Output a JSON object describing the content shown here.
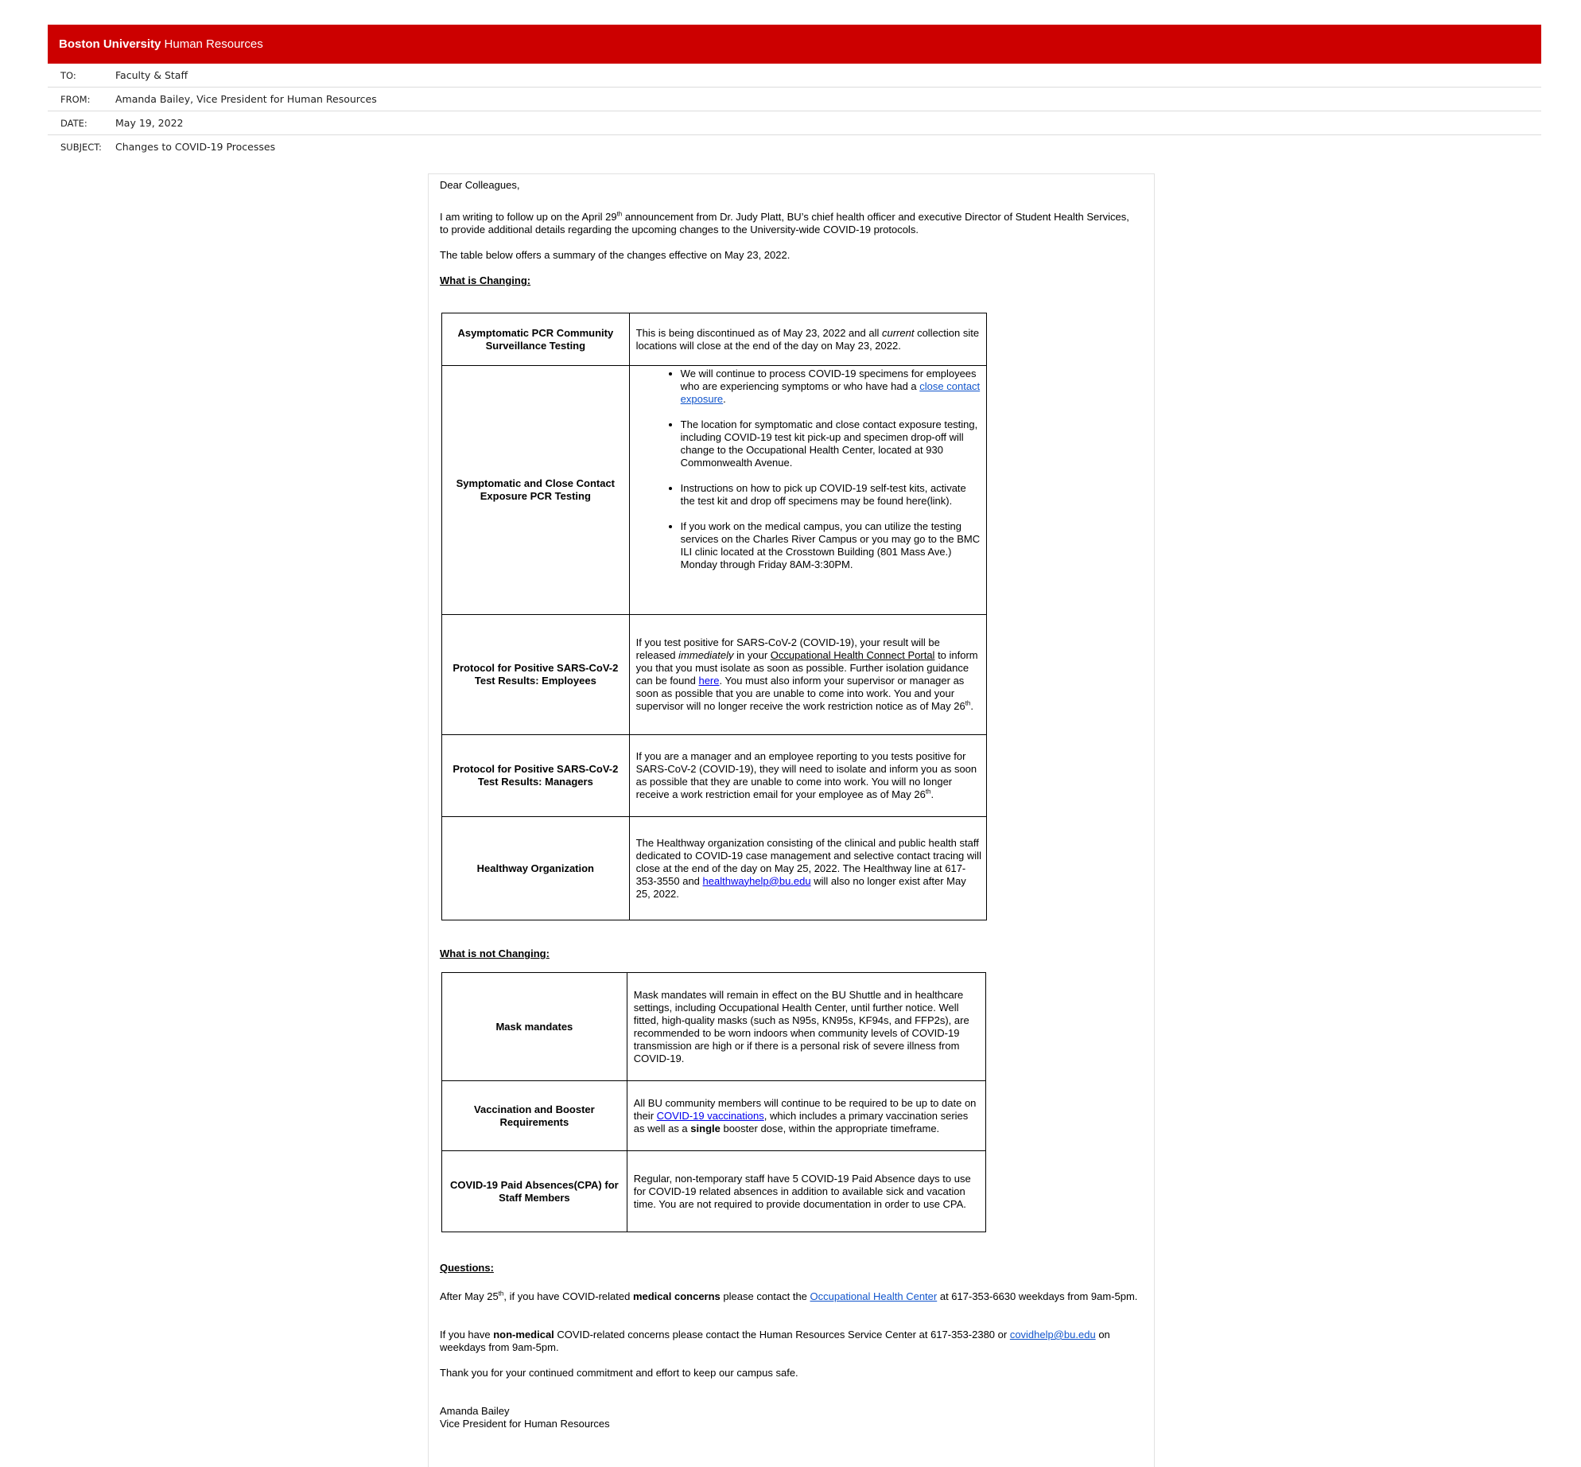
{
  "header": {
    "brand": "Boston University",
    "department": "Human Resources",
    "to_label": "TO:",
    "to_value": "Faculty & Staff",
    "from_label": "FROM:",
    "from_value": "Amanda Bailey, Vice President for Human Resources",
    "date_label": "DATE:",
    "date_value": "May 19, 2022",
    "subject_label": "SUBJECT:",
    "subject_value": "Changes to COVID-19 Processes"
  },
  "letter": {
    "greeting": "Dear Colleagues,",
    "intro_a": "I am writing to follow up on the April 29",
    "intro_sup": "th",
    "intro_b": " announcement from Dr. Judy Platt, BU’s chief health officer and executive Director of Student Health Services, to provide additional details regarding the upcoming changes to the University-wide COVID-19 protocols.",
    "summary": "The table below offers a summary of the changes effective on May 23, 2022.",
    "changing_heading": "What is Changing:",
    "not_changing_heading": "What is not Changing:",
    "questions_heading": "Questions:",
    "q1_a": "After May 25",
    "q1_sup": "th",
    "q1_b": ", if you have COVID-related ",
    "q1_bold": "medical concerns",
    "q1_c": " please contact the ",
    "q1_link": "Occupational Health Center",
    "q1_d": " at 617-353-6630 weekdays from 9am-5pm.",
    "q2_a": "If you have ",
    "q2_bold": "non-medical",
    "q2_b": " COVID-related concerns please contact the Human Resources Service Center at 617-353-2380 or ",
    "q2_link": "covidhelp@bu.edu",
    "q2_c": " on weekdays from 9am-5pm.",
    "thanks": "Thank you for your continued commitment and effort to keep our campus safe.",
    "sig_name": "Amanda Bailey",
    "sig_title": "Vice President for Human Resources"
  },
  "changing_table": {
    "r1_label": "Asymptomatic PCR Community Surveillance Testing",
    "r1_a": "This is being discontinued as of May 23, 2022 and all ",
    "r1_em": "current",
    "r1_b": " collection site locations will close at the end of the day on May 23, 2022.",
    "r2_label": "Symptomatic and Close Contact Exposure PCR Testing",
    "r2_b1_a": "We will continue to process COVID-19 specimens for employees who are experiencing symptoms or who have had a ",
    "r2_b1_link": "close contact exposure",
    "r2_b1_b": ".",
    "r2_b2": "The location for symptomatic and close contact exposure testing, including COVID-19 test kit pick-up and specimen drop-off will change to the Occupational Health Center, located at 930 Commonwealth Avenue.",
    "r2_b3": "Instructions on how to pick up COVID-19 self-test kits, activate the test kit and drop off specimens may be found here(link).",
    "r2_b4": "If you work on the medical campus, you can utilize the testing services on the Charles River Campus or you may go to the BMC ILI clinic located at the Crosstown Building (801 Mass Ave.) Monday through Friday 8AM-3:30PM.",
    "r3_label": "Protocol for Positive SARS-CoV-2 Test Results: Employees",
    "r3_a": "If you test positive for SARS-CoV-2 (COVID-19), your result will be released ",
    "r3_em": "immediately",
    "r3_b": " in your ",
    "r3_u": "Occupational Health Connect Portal",
    "r3_c": " to inform you that you must isolate as soon as possible. Further isolation guidance can be found ",
    "r3_link": "here",
    "r3_d": ". You must also inform your supervisor or manager as soon as possible that you are unable to come into work. You and your supervisor will no longer receive the work restriction notice as of May 26",
    "r3_sup": "th",
    "r3_e": ".",
    "r4_label": "Protocol for Positive SARS-CoV-2 Test Results: Managers",
    "r4_a": "If you are a manager and an employee reporting to you tests positive for SARS-CoV-2 (COVID-19), they will need to isolate and inform you as soon as possible that they are unable to come into work. You will no longer receive a work restriction email for your employee as of May 26",
    "r4_sup": "th",
    "r4_b": ".",
    "r5_label": "Healthway Organization",
    "r5_a": "The Healthway organization consisting of the clinical and public health staff dedicated to COVID-19 case management and selective contact tracing will close at the end of the day on May 25, 2022.  The Healthway line at 617-353-3550 and ",
    "r5_link": "healthwayhelp@bu.edu",
    "r5_b": " will also no longer exist after May 25, 2022."
  },
  "not_changing_table": {
    "r1_label": "Mask mandates",
    "r1_text": "Mask mandates will remain in effect on the BU Shuttle and in healthcare settings, including Occupational Health Center, until further notice. Well fitted, high-quality masks (such as N95s, KN95s, KF94s, and FFP2s), are recommended to be worn indoors when community levels of COVID-19 transmission are high or if there is a personal risk of severe illness from COVID-19.",
    "r2_label": "Vaccination and Booster Requirements",
    "r2_a": "All BU community members will continue to be required to be up to date on their ",
    "r2_link": "COVID-19 vaccinations",
    "r2_b": ", which includes a primary vaccination series as well as a ",
    "r2_bold": "single",
    "r2_c": " booster dose, within the appropriate timeframe.",
    "r3_label": "COVID-19 Paid Absences(CPA) for Staff Members",
    "r3_text": "Regular, non-temporary staff have 5 COVID-19 Paid Absence days to use for COVID-19 related absences in addition to available sick and vacation time. You are not required to provide documentation in order to use CPA."
  }
}
